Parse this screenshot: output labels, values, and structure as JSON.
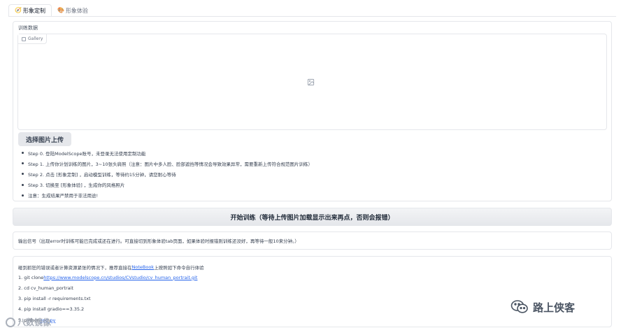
{
  "tabs": [
    {
      "icon": "🧭",
      "label": "形象定制",
      "active": true
    },
    {
      "icon": "🎨",
      "label": "形象体验",
      "active": false
    }
  ],
  "upload": {
    "section_label": "训练数据",
    "gallery_label": "Gallery",
    "upload_button": "选择图片上传",
    "steps": [
      "Step 0. 登陆ModelScope账号，未登录无法使用定制功能",
      "Step 1. 上传你计划训练的图片，3~10张头肩照（注意：图片中多人脸、脸部遮挡等情况会导致效果异常，需要重新上传符合规范图片训练）",
      "Step 2. 点击 [形象定制] ，启动模型训练，等待约15分钟，请您耐心等待",
      "Step 3. 切换至 [形象体验] ，生成你的风格照片",
      "注意：生成结果严禁用于非法用途!"
    ]
  },
  "train_button": "开始训练（等待上传图片加载显示出来再点，否则会报错）",
  "output": {
    "text": "输出信号（出现error时训练可能已完成或还在进行。可直接切到形象体验tab页面，如果体验时报错则训练还没好，再等待一般10来分钟。）"
  },
  "info": {
    "line0_pre": "碰到抓狂的错误或者计算资源紧张的情况下，推荐直接在",
    "line0_link": "NoteBook",
    "line0_post": "上按照如下命令自行体验",
    "line1_pre": "1. git clone ",
    "line1_link": "https://www.modelscope.cn/studios/CVstudio/cv_human_portrait.git",
    "line2": "2. cd cv_human_portrait",
    "line3": "3. pip install -r requirements.txt",
    "line4": "4. pip install gradio==3.35.2",
    "line5_pre": "5. python ",
    "line5_link": "app.py"
  },
  "watermarks": {
    "left": "八数镜像",
    "right": "路上侠客"
  },
  "colors": {
    "link": "#2563eb",
    "border": "#e5e7eb",
    "button_bg": "#e5e7eb"
  }
}
